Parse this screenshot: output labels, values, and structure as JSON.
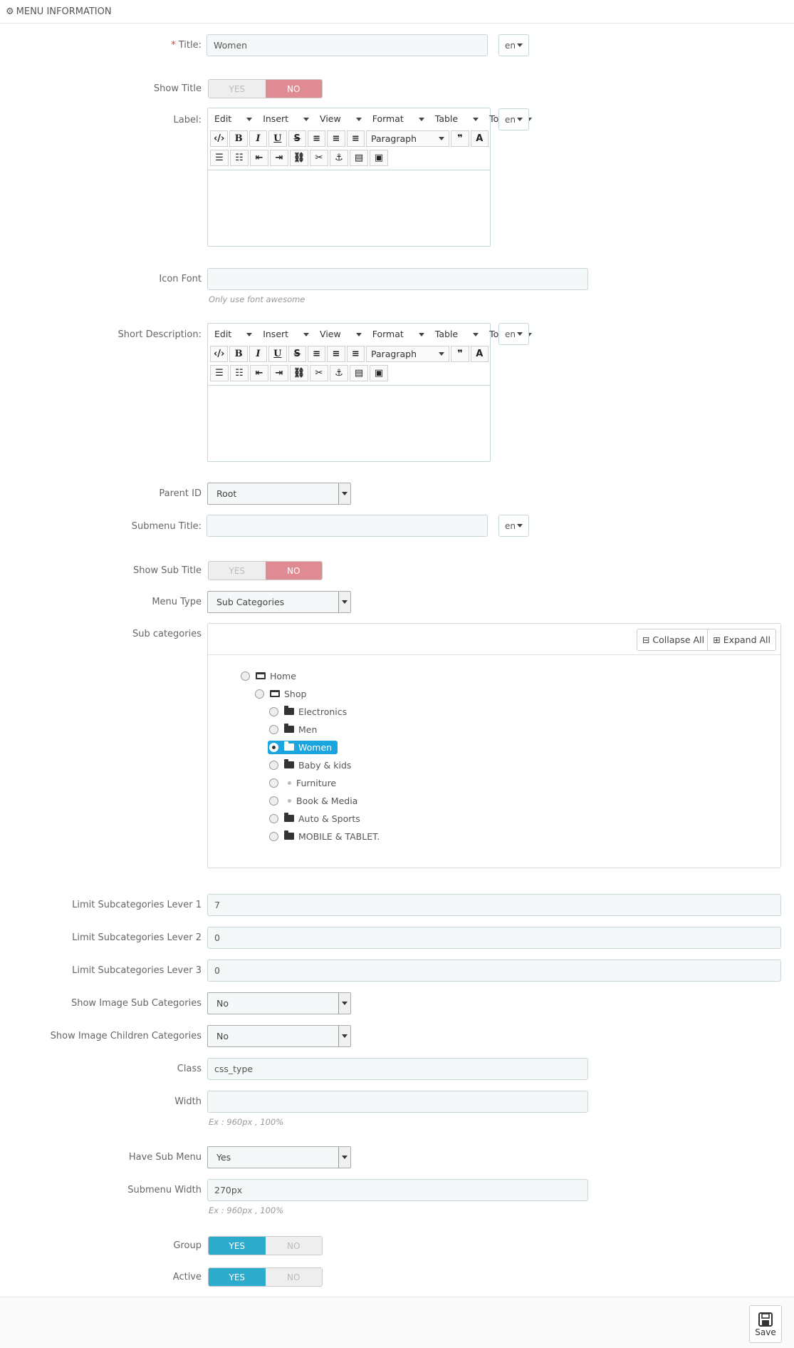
{
  "panel": {
    "title": "MENU INFORMATION"
  },
  "fields": {
    "title": {
      "label": "Title:",
      "value": "Women",
      "lang": "en"
    },
    "show_title": {
      "label": "Show Title",
      "yes": "YES",
      "no": "NO",
      "selected": "no"
    },
    "label": {
      "label": "Label:",
      "lang": "en"
    },
    "icon_font": {
      "label": "Icon Font",
      "value": "",
      "help": "Only use font awesome"
    },
    "short_description": {
      "label": "Short Description:",
      "lang": "en"
    },
    "parent_id": {
      "label": "Parent ID",
      "value": "Root"
    },
    "submenu_title": {
      "label": "Submenu Title:",
      "value": "",
      "lang": "en"
    },
    "show_sub_title": {
      "label": "Show Sub Title",
      "yes": "YES",
      "no": "NO",
      "selected": "no"
    },
    "menu_type": {
      "label": "Menu Type",
      "value": "Sub Categories"
    },
    "sub_categories": {
      "label": "Sub categories",
      "collapse_all": "Collapse All",
      "expand_all": "Expand All",
      "tree": [
        {
          "label": "Home",
          "icon": "folder-open-icon"
        },
        {
          "label": "Shop",
          "icon": "folder-open-icon"
        },
        {
          "label": "Electronics",
          "icon": "folder-icon"
        },
        {
          "label": "Men",
          "icon": "folder-icon"
        },
        {
          "label": "Women",
          "icon": "folder-icon",
          "selected": true
        },
        {
          "label": "Baby & kids",
          "icon": "folder-icon"
        },
        {
          "label": "Furniture",
          "icon": "bullet-icon"
        },
        {
          "label": "Book & Media",
          "icon": "bullet-icon"
        },
        {
          "label": "Auto & Sports",
          "icon": "folder-icon"
        },
        {
          "label": "MOBILE & TABLET.",
          "icon": "folder-icon"
        }
      ]
    },
    "limit_lever1": {
      "label": "Limit Subcategories Lever 1",
      "value": "7"
    },
    "limit_lever2": {
      "label": "Limit Subcategories Lever 2",
      "value": "0"
    },
    "limit_lever3": {
      "label": "Limit Subcategories Lever 3",
      "value": "0"
    },
    "show_image_sub": {
      "label": "Show Image Sub Categories",
      "value": "No"
    },
    "show_image_children": {
      "label": "Show Image Children Categories",
      "value": "No"
    },
    "class": {
      "label": "Class",
      "value": "css_type"
    },
    "width": {
      "label": "Width",
      "value": "",
      "help": "Ex : 960px , 100%"
    },
    "have_sub_menu": {
      "label": "Have Sub Menu",
      "value": "Yes"
    },
    "submenu_width": {
      "label": "Submenu Width",
      "value": "270px",
      "help": "Ex : 960px , 100%"
    },
    "group": {
      "label": "Group",
      "yes": "YES",
      "no": "NO",
      "selected": "yes"
    },
    "active": {
      "label": "Active",
      "yes": "YES",
      "no": "NO",
      "selected": "yes"
    }
  },
  "editor": {
    "menus": [
      "Edit",
      "Insert",
      "View",
      "Format",
      "Table",
      "Tools"
    ],
    "block_format": "Paragraph"
  },
  "footer": {
    "save_label": "Save"
  }
}
